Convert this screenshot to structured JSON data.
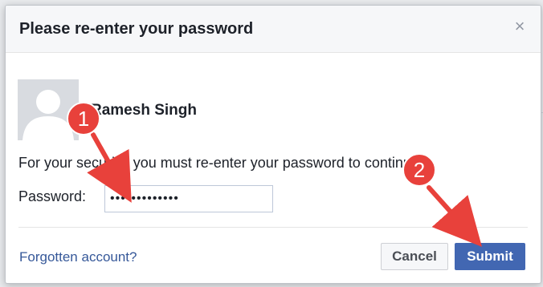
{
  "dialog": {
    "title": "Please re-enter your password",
    "close_icon": "close-icon"
  },
  "user": {
    "name": "Ramesh Singh",
    "avatar_icon": "default-avatar-silhouette"
  },
  "message": "For your security, you must re-enter your password to continue.",
  "password": {
    "label": "Password:",
    "value": "•••••••••••••"
  },
  "footer": {
    "forgot_link": "Forgotten account?",
    "cancel_label": "Cancel",
    "submit_label": "Submit"
  },
  "annotations": [
    {
      "number": "1"
    },
    {
      "number": "2"
    }
  ],
  "colors": {
    "accent": "#4267b2",
    "link": "#365899",
    "annotation_red": "#e8413b"
  }
}
